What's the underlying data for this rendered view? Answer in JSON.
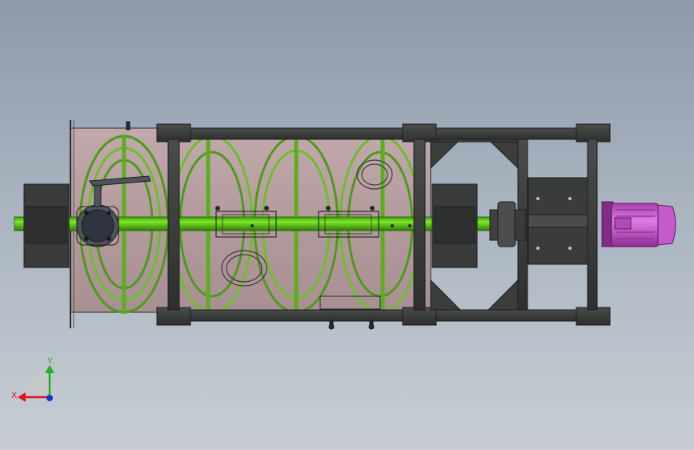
{
  "viewport": {
    "colors": {
      "background_top": "#8c9aab",
      "background_bottom": "#c7cdd3",
      "trough": "#b49c9e",
      "frame": "#3b3d3d",
      "shaft": "#5fd313",
      "ribbon": "#5aa31c",
      "motor": "#c25ac6",
      "valve": "#545b66"
    }
  },
  "triad": {
    "x_label": "X",
    "y_label": "Y",
    "x_color": "#e0141c",
    "y_color": "#20b020",
    "z_color": "#1b2fd6"
  }
}
